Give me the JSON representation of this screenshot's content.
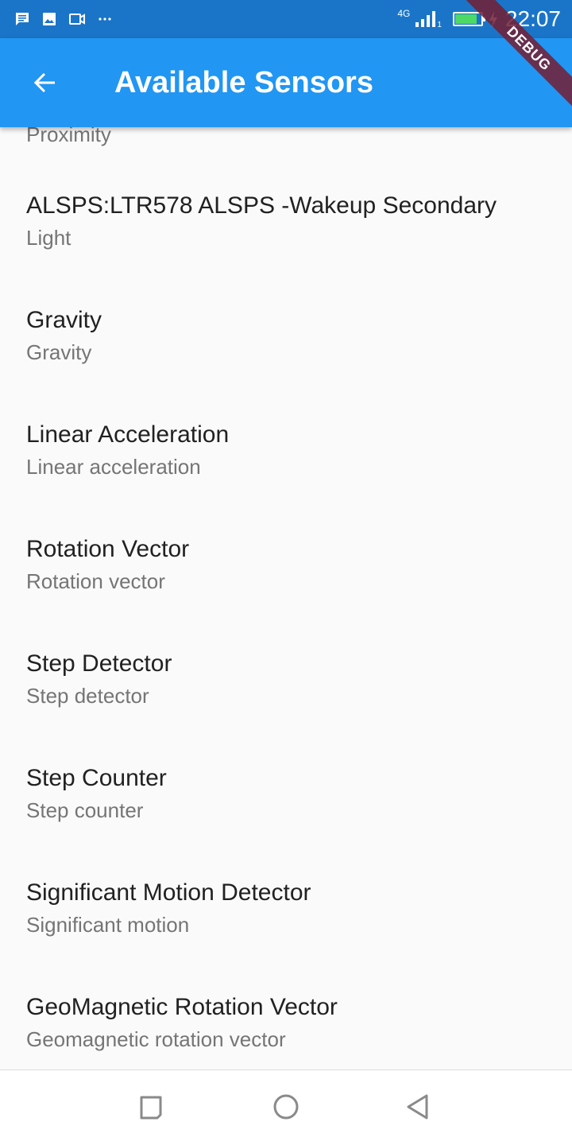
{
  "status_bar": {
    "network_type": "4G",
    "sim_slot": "1",
    "time": "22:07",
    "battery_level": 0.85,
    "icons": [
      "message-icon",
      "image-icon",
      "video-icon",
      "more-icon",
      "signal-icon",
      "battery-icon",
      "charging-icon"
    ]
  },
  "app_bar": {
    "title": "Available Sensors",
    "back_icon": "arrow-left-icon",
    "color": "#2196f3"
  },
  "debug_banner": "DEBUG",
  "list": {
    "partial_item_type": "Proximity",
    "items": [
      {
        "name": "ALSPS:LTR578 ALSPS -Wakeup Secondary",
        "type": "Light"
      },
      {
        "name": "Gravity",
        "type": "Gravity"
      },
      {
        "name": "Linear Acceleration",
        "type": "Linear acceleration"
      },
      {
        "name": "Rotation Vector",
        "type": "Rotation vector"
      },
      {
        "name": "Step Detector",
        "type": "Step detector"
      },
      {
        "name": "Step Counter",
        "type": "Step counter"
      },
      {
        "name": "Significant Motion Detector",
        "type": "Significant motion"
      },
      {
        "name": "GeoMagnetic Rotation Vector",
        "type": "Geomagnetic rotation vector"
      }
    ]
  },
  "nav_bar": {
    "buttons": [
      "recents-icon",
      "home-icon",
      "back-triangle-icon"
    ]
  }
}
